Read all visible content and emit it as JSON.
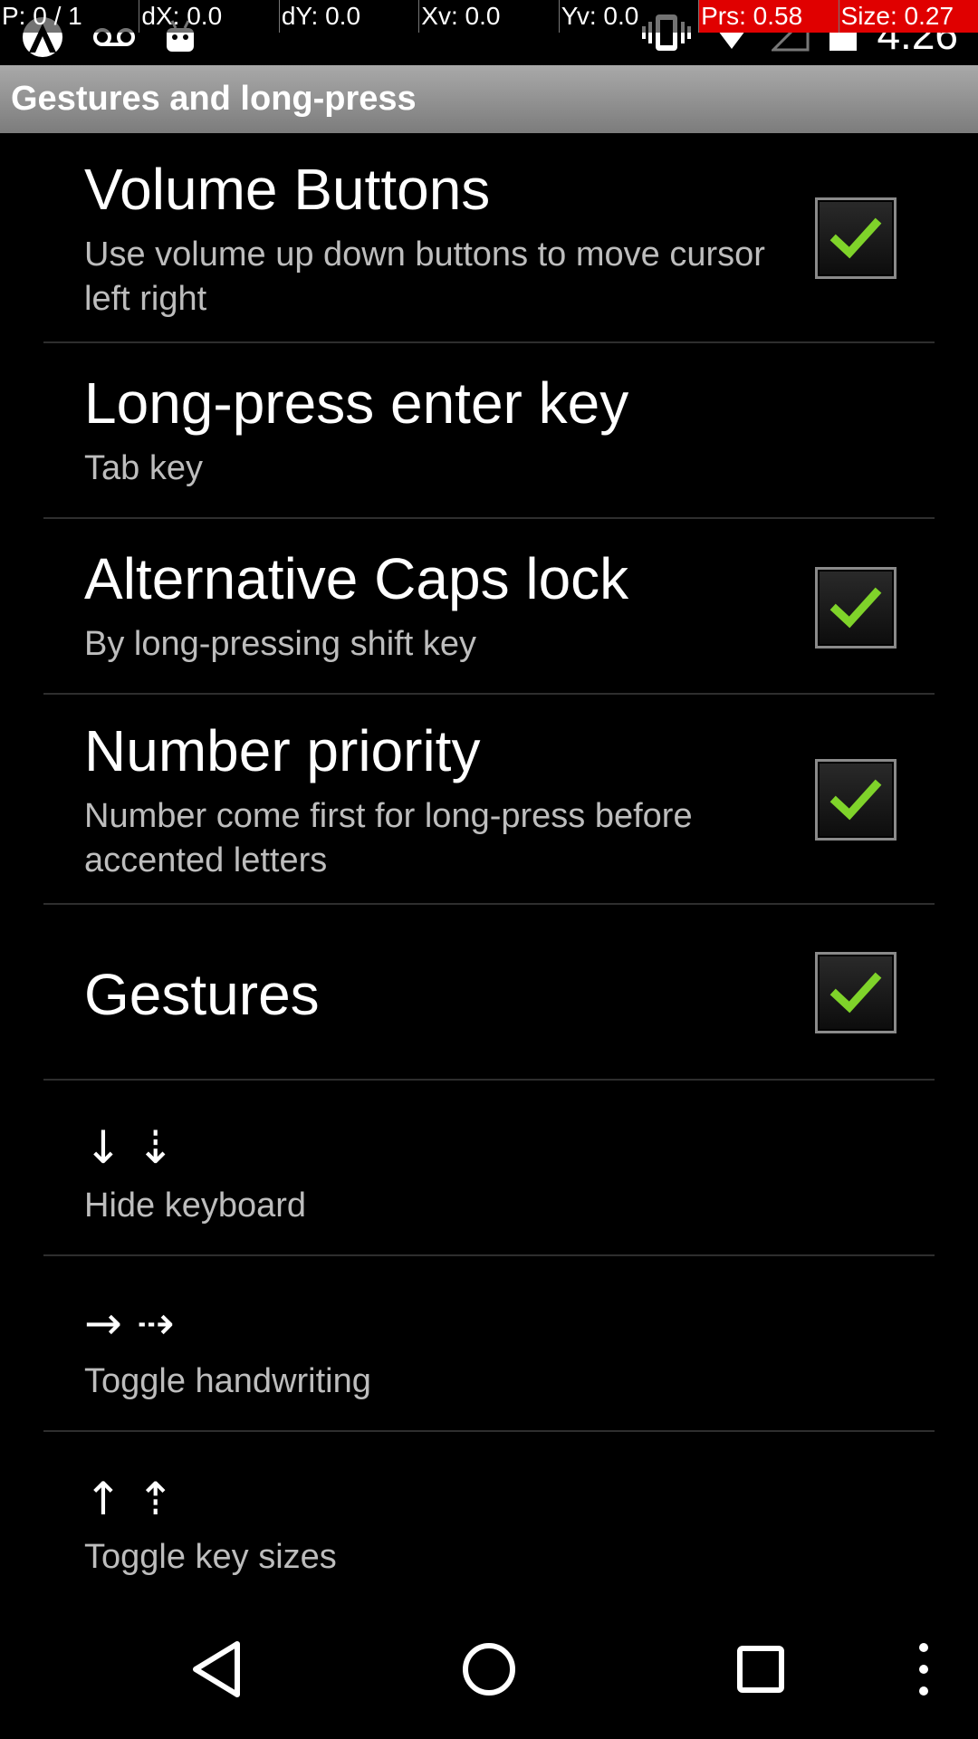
{
  "debug_overlay": {
    "pointer": "P: 0 / 1",
    "dx": "dX: 0.0",
    "dy": "dY: 0.0",
    "xv": "Xv: 0.0",
    "yv": "Yv: 0.0",
    "pressure": "Prs: 0.58",
    "size": "Size: 0.27",
    "highlight_color": "#e00000"
  },
  "status_bar": {
    "time": "4:26",
    "left_icons": [
      "notification-app-icon",
      "voicemail-icon",
      "android-robot-icon"
    ],
    "right_icons": [
      "vibrate-icon",
      "wifi-icon",
      "cell-signal-icon",
      "battery-icon"
    ]
  },
  "action_bar": {
    "title": "Gestures and long-press"
  },
  "preferences": [
    {
      "title": "Volume Buttons",
      "summary": "Use volume up down buttons to move cursor left right",
      "checked": true
    },
    {
      "title": "Long-press enter key",
      "summary": "Tab key"
    },
    {
      "title": "Alternative Caps lock",
      "summary": "By long-pressing shift key",
      "checked": true
    },
    {
      "title": "Number priority",
      "summary": "Number come first for long-press before accented letters",
      "checked": true
    },
    {
      "title": "Gestures",
      "checked": true
    },
    {
      "glyph": "↓ ⇣",
      "summary": "Hide keyboard"
    },
    {
      "glyph": "→  ⇢",
      "summary": "Toggle handwriting"
    },
    {
      "glyph": "↑ ⇡",
      "summary": "Toggle key sizes"
    }
  ],
  "colors": {
    "checkmark": "#7fd32a",
    "action_bar_top": "#a9a9a9",
    "action_bar_bottom": "#7c7c7c",
    "summary_text": "#bdbdbd"
  },
  "nav_bar": {
    "buttons": [
      "back-icon",
      "home-icon",
      "recents-icon",
      "overflow-menu-icon"
    ]
  }
}
